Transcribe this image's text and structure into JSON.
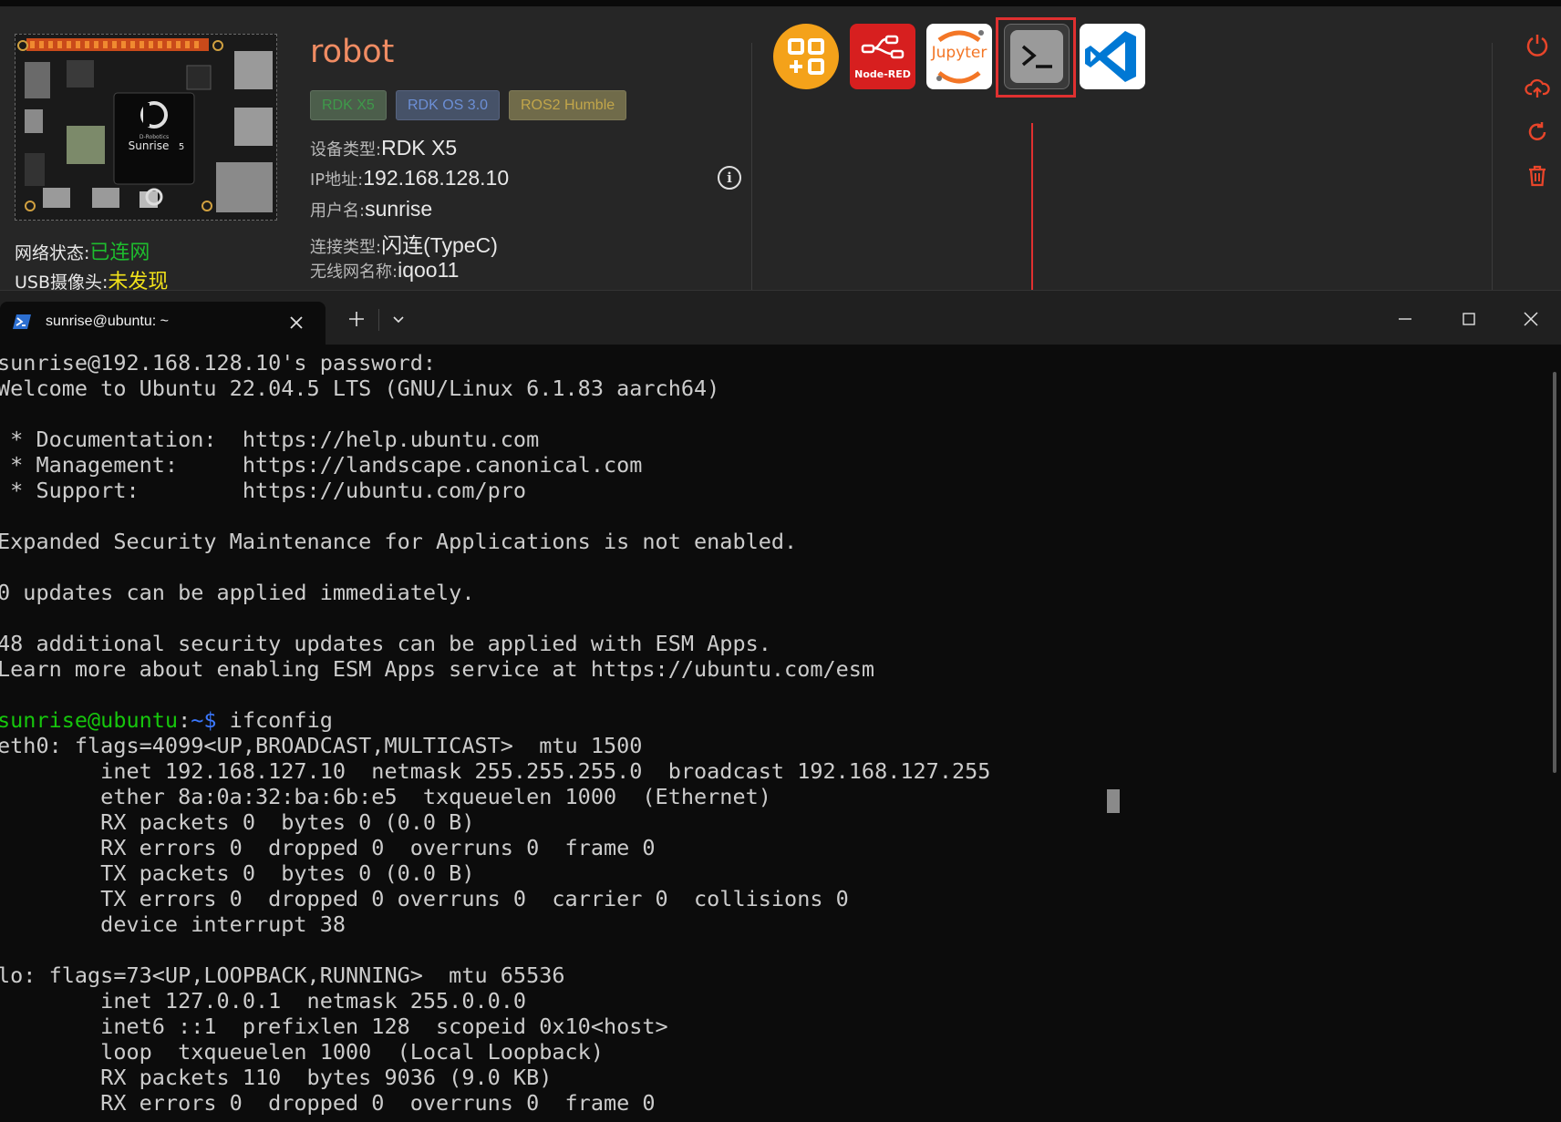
{
  "device": {
    "name": "robot",
    "tags": [
      "RDK X5",
      "RDK OS 3.0",
      "ROS2 Humble"
    ],
    "board_chip_label": "Sunrise",
    "board_chip_suffix": "5",
    "board_brand": "D-Robotics",
    "info": {
      "device_type_label": "设备类型:",
      "device_type_value": "RDK X5",
      "ip_label": "IP地址:",
      "ip_value": "192.168.128.10",
      "user_label": "用户名:",
      "user_value": "sunrise",
      "conn_label": "连接类型:",
      "conn_value": "闪连(TypeC)",
      "wifi_label": "无线网名称:",
      "wifi_value": "iqoo11"
    },
    "status": {
      "network_label": "网络状态:",
      "network_value": "已连网",
      "network_color": "#1ebd2e",
      "camera_label": "USB摄像头:",
      "camera_value": "未发现",
      "camera_color": "#f2e21a"
    }
  },
  "apps": {
    "items": [
      "apps-grid-icon",
      "Node-RED",
      "Jupyter",
      "terminal-icon",
      "vscode-icon"
    ],
    "nodered_label": "Node-RED",
    "jupyter_label": "Jupyter",
    "highlight_color": "#e03030"
  },
  "side_actions": [
    "power-icon",
    "cloud-upload-icon",
    "refresh-icon",
    "trash-icon"
  ],
  "terminal": {
    "tab_title": "sunrise@ubuntu: ~",
    "prompt_user": "sunrise@ubuntu",
    "prompt_sep": ":",
    "prompt_path": "~$",
    "command": " ifconfig",
    "lines_before": [
      "sunrise@192.168.128.10's password:",
      "Welcome to Ubuntu 22.04.5 LTS (GNU/Linux 6.1.83 aarch64)",
      "",
      " * Documentation:  https://help.ubuntu.com",
      " * Management:     https://landscape.canonical.com",
      " * Support:        https://ubuntu.com/pro",
      "",
      "Expanded Security Maintenance for Applications is not enabled.",
      "",
      "0 updates can be applied immediately.",
      "",
      "48 additional security updates can be applied with ESM Apps.",
      "Learn more about enabling ESM Apps service at https://ubuntu.com/esm",
      ""
    ],
    "lines_after": [
      "eth0: flags=4099<UP,BROADCAST,MULTICAST>  mtu 1500",
      "        inet 192.168.127.10  netmask 255.255.255.0  broadcast 192.168.127.255",
      "        ether 8a:0a:32:ba:6b:e5  txqueuelen 1000  (Ethernet)",
      "        RX packets 0  bytes 0 (0.0 B)",
      "        RX errors 0  dropped 0  overruns 0  frame 0",
      "        TX packets 0  bytes 0 (0.0 B)",
      "        TX errors 0  dropped 0 overruns 0  carrier 0  collisions 0",
      "        device interrupt 38",
      "",
      "lo: flags=73<UP,LOOPBACK,RUNNING>  mtu 65536",
      "        inet 127.0.0.1  netmask 255.0.0.0",
      "        inet6 ::1  prefixlen 128  scopeid 0x10<host>",
      "        loop  txqueuelen 1000  (Local Loopback)",
      "        RX packets 110  bytes 9036 (9.0 KB)",
      "        RX errors 0  dropped 0  overruns 0  frame 0"
    ]
  }
}
